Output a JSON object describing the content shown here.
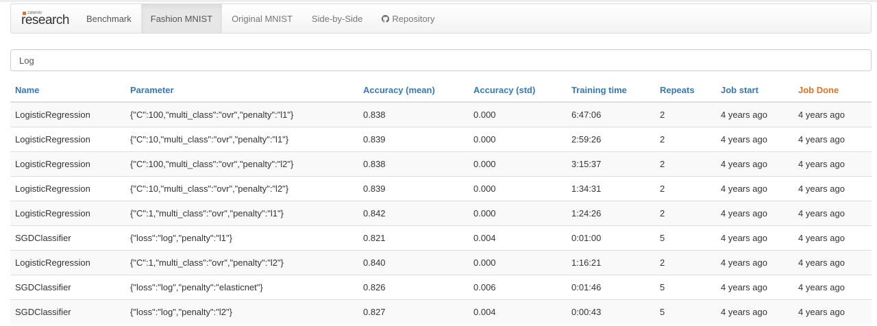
{
  "brand": {
    "small": "zalando",
    "main": "research"
  },
  "nav": {
    "items": [
      {
        "label": "Benchmark",
        "active": false
      },
      {
        "label": "Fashion MNIST",
        "active": true
      },
      {
        "label": "Original MNIST",
        "active": false
      },
      {
        "label": "Side-by-Side",
        "active": false
      },
      {
        "label": "Repository",
        "active": false,
        "icon": "github-icon"
      }
    ]
  },
  "search": {
    "value": "Log",
    "placeholder": ""
  },
  "colors": {
    "header_link": "#337ab7",
    "sorted_header": "#e8711c",
    "brand_accent": "#ff6900"
  },
  "table": {
    "headers": [
      "Name",
      "Parameter",
      "Accuracy (mean)",
      "Accuracy (std)",
      "Training time",
      "Repeats",
      "Job start",
      "Job Done"
    ],
    "sorted_column": "Job Done",
    "rows": [
      [
        "LogisticRegression",
        "{\"C\":100,\"multi_class\":\"ovr\",\"penalty\":\"l1\"}",
        "0.838",
        "0.000",
        "6:47:06",
        "2",
        "4 years ago",
        "4 years ago"
      ],
      [
        "LogisticRegression",
        "{\"C\":10,\"multi_class\":\"ovr\",\"penalty\":\"l1\"}",
        "0.839",
        "0.000",
        "2:59:26",
        "2",
        "4 years ago",
        "4 years ago"
      ],
      [
        "LogisticRegression",
        "{\"C\":100,\"multi_class\":\"ovr\",\"penalty\":\"l2\"}",
        "0.838",
        "0.000",
        "3:15:37",
        "2",
        "4 years ago",
        "4 years ago"
      ],
      [
        "LogisticRegression",
        "{\"C\":10,\"multi_class\":\"ovr\",\"penalty\":\"l2\"}",
        "0.839",
        "0.000",
        "1:34:31",
        "2",
        "4 years ago",
        "4 years ago"
      ],
      [
        "LogisticRegression",
        "{\"C\":1,\"multi_class\":\"ovr\",\"penalty\":\"l1\"}",
        "0.842",
        "0.000",
        "1:24:26",
        "2",
        "4 years ago",
        "4 years ago"
      ],
      [
        "SGDClassifier",
        "{\"loss\":\"log\",\"penalty\":\"l1\"}",
        "0.821",
        "0.004",
        "0:01:00",
        "5",
        "4 years ago",
        "4 years ago"
      ],
      [
        "LogisticRegression",
        "{\"C\":1,\"multi_class\":\"ovr\",\"penalty\":\"l2\"}",
        "0.840",
        "0.000",
        "1:16:21",
        "2",
        "4 years ago",
        "4 years ago"
      ],
      [
        "SGDClassifier",
        "{\"loss\":\"log\",\"penalty\":\"elasticnet\"}",
        "0.826",
        "0.006",
        "0:01:46",
        "5",
        "4 years ago",
        "4 years ago"
      ],
      [
        "SGDClassifier",
        "{\"loss\":\"log\",\"penalty\":\"l2\"}",
        "0.827",
        "0.004",
        "0:00:43",
        "5",
        "4 years ago",
        "4 years ago"
      ]
    ]
  }
}
